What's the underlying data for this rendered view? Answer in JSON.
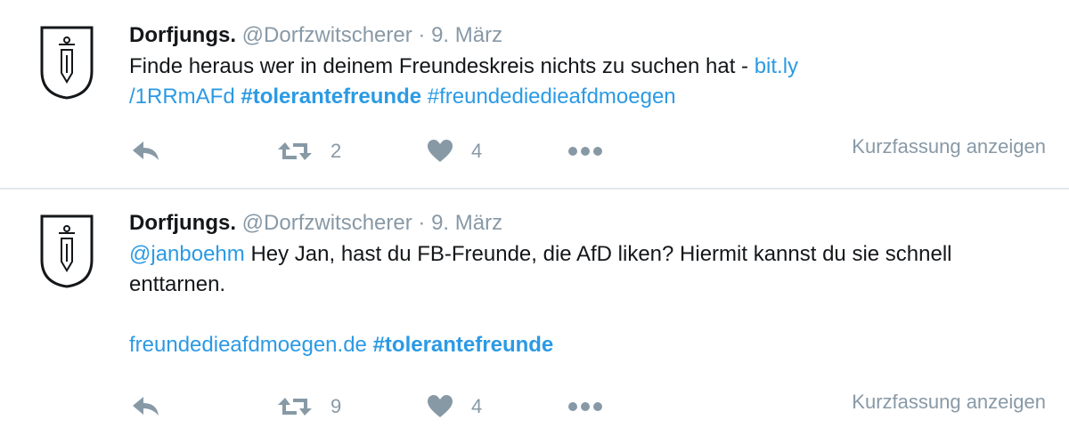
{
  "tweets": [
    {
      "fullname": "Dorfjungs.",
      "username": "@Dorfzwitscherer",
      "separator": "·",
      "date": "9. März",
      "text_plain": "Finde heraus wer in deinem Freundeskreis nichts zu suchen hat - ",
      "link_line1": "bit.ly",
      "link_line2": "/1RRmAFd",
      "hashtag1": "#tolerantefreunde",
      "hashtag2": "#freundediedieafdmoegen",
      "retweet_count": "2",
      "like_count": "4",
      "summary_label": "Kurzfassung anzeigen"
    },
    {
      "fullname": "Dorfjungs.",
      "username": "@Dorfzwitscherer",
      "separator": "·",
      "date": "9. März",
      "mention": "@janboehm",
      "text_plain": " Hey Jan, hast du FB-Freunde, die AfD liken? Hiermit kannst du sie schnell enttarnen.",
      "link": "freundedieafdmoegen.de",
      "hashtag": "#tolerantefreunde",
      "retweet_count": "9",
      "like_count": "4",
      "summary_label": "Kurzfassung anzeigen"
    }
  ],
  "icons": {
    "avatar": "dorfjungs-shield-logo",
    "reply": "reply-icon",
    "retweet": "retweet-icon",
    "like": "heart-icon",
    "more": "more-dots-icon"
  },
  "colors": {
    "link": "#2b9ae4",
    "muted": "#8899a6",
    "text": "#14171a",
    "divider": "#e1e8ed"
  }
}
